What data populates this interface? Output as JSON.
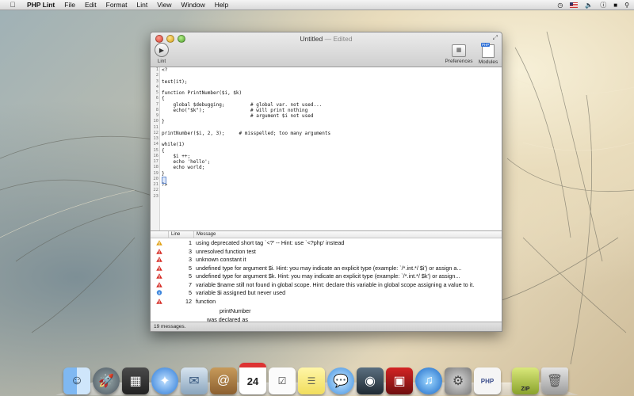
{
  "menubar": {
    "app_name": "PHP Lint",
    "items": [
      "File",
      "Edit",
      "Format",
      "Lint",
      "View",
      "Window",
      "Help"
    ]
  },
  "window": {
    "title": "Untitled",
    "title_suffix": "— Edited",
    "toolbar": {
      "lint_label": "Lint",
      "preferences_label": "Preferences",
      "modules_label": "Modules",
      "modules_badge": "PHP"
    },
    "line_numbers": [
      "1",
      "2",
      "3",
      "4",
      "5",
      "6",
      "7",
      "8",
      "9",
      "10",
      "11",
      "12",
      "13",
      "14",
      "15",
      "16",
      "17",
      "18",
      "19",
      "20",
      "21",
      "22",
      "23"
    ],
    "code_lines": [
      "<?",
      "",
      "test(it);",
      "",
      "function PrintNumber($i, $k)",
      "{",
      "    global $debugging;         # global var. not used...",
      "    echo(\"$k\");                # will print nothing",
      "                               # argument $i not used",
      "}",
      "",
      "printNumber($i, 2, 3);     # misspelled; too many arguments",
      "",
      "while(1)",
      "{",
      "    $i ++;",
      "    echo 'hello';",
      "    echo world;",
      "}",
      "",
      "?>",
      "",
      ""
    ],
    "messages": {
      "col_line": "Line",
      "col_message": "Message",
      "rows": [
        {
          "kind": "warning",
          "line": "1",
          "text": "using deprecated short tag `<?' -- Hint: use `<?php' instead"
        },
        {
          "kind": "error",
          "line": "3",
          "text": "unresolved function test"
        },
        {
          "kind": "error",
          "line": "3",
          "text": "unknown constant it"
        },
        {
          "kind": "error",
          "line": "5",
          "text": "undefined type for argument $i. Hint: you may indicate an explicit type (example: `/*.int.*/ $i') or assign a..."
        },
        {
          "kind": "error",
          "line": "5",
          "text": "undefined type for argument $k. Hint: you may indicate an explicit type (example: `/*.int.*/ $k') or assign..."
        },
        {
          "kind": "error",
          "line": "7",
          "text": "variable $name still not found in global scope. Hint: declare this variable in global scope assigning a value to it."
        },
        {
          "kind": "info",
          "line": "5",
          "text": "variable $i assigned but never used"
        },
        {
          "kind": "error",
          "line": "12",
          "text": "function"
        }
      ],
      "extra_1": "printNumber",
      "extra_2": "was declared as"
    },
    "status": "19 messages."
  },
  "dock": {
    "items": [
      "finder-icon",
      "launchpad-icon",
      "mission-control-icon",
      "safari-icon",
      "mail-icon",
      "contacts-icon",
      "calendar-icon",
      "reminders-icon",
      "notes-icon",
      "messages-icon",
      "facetime-icon",
      "photo-booth-icon",
      "itunes-icon",
      "system-preferences-icon",
      "php-lint-icon",
      "zip-archive-icon",
      "trash-icon"
    ],
    "calendar_day": "24",
    "php_badge": "PHP",
    "zip_label": "ZIP"
  },
  "colors": {
    "error": "#d62b24",
    "warning": "#e0a012",
    "info": "#3f87dd"
  }
}
